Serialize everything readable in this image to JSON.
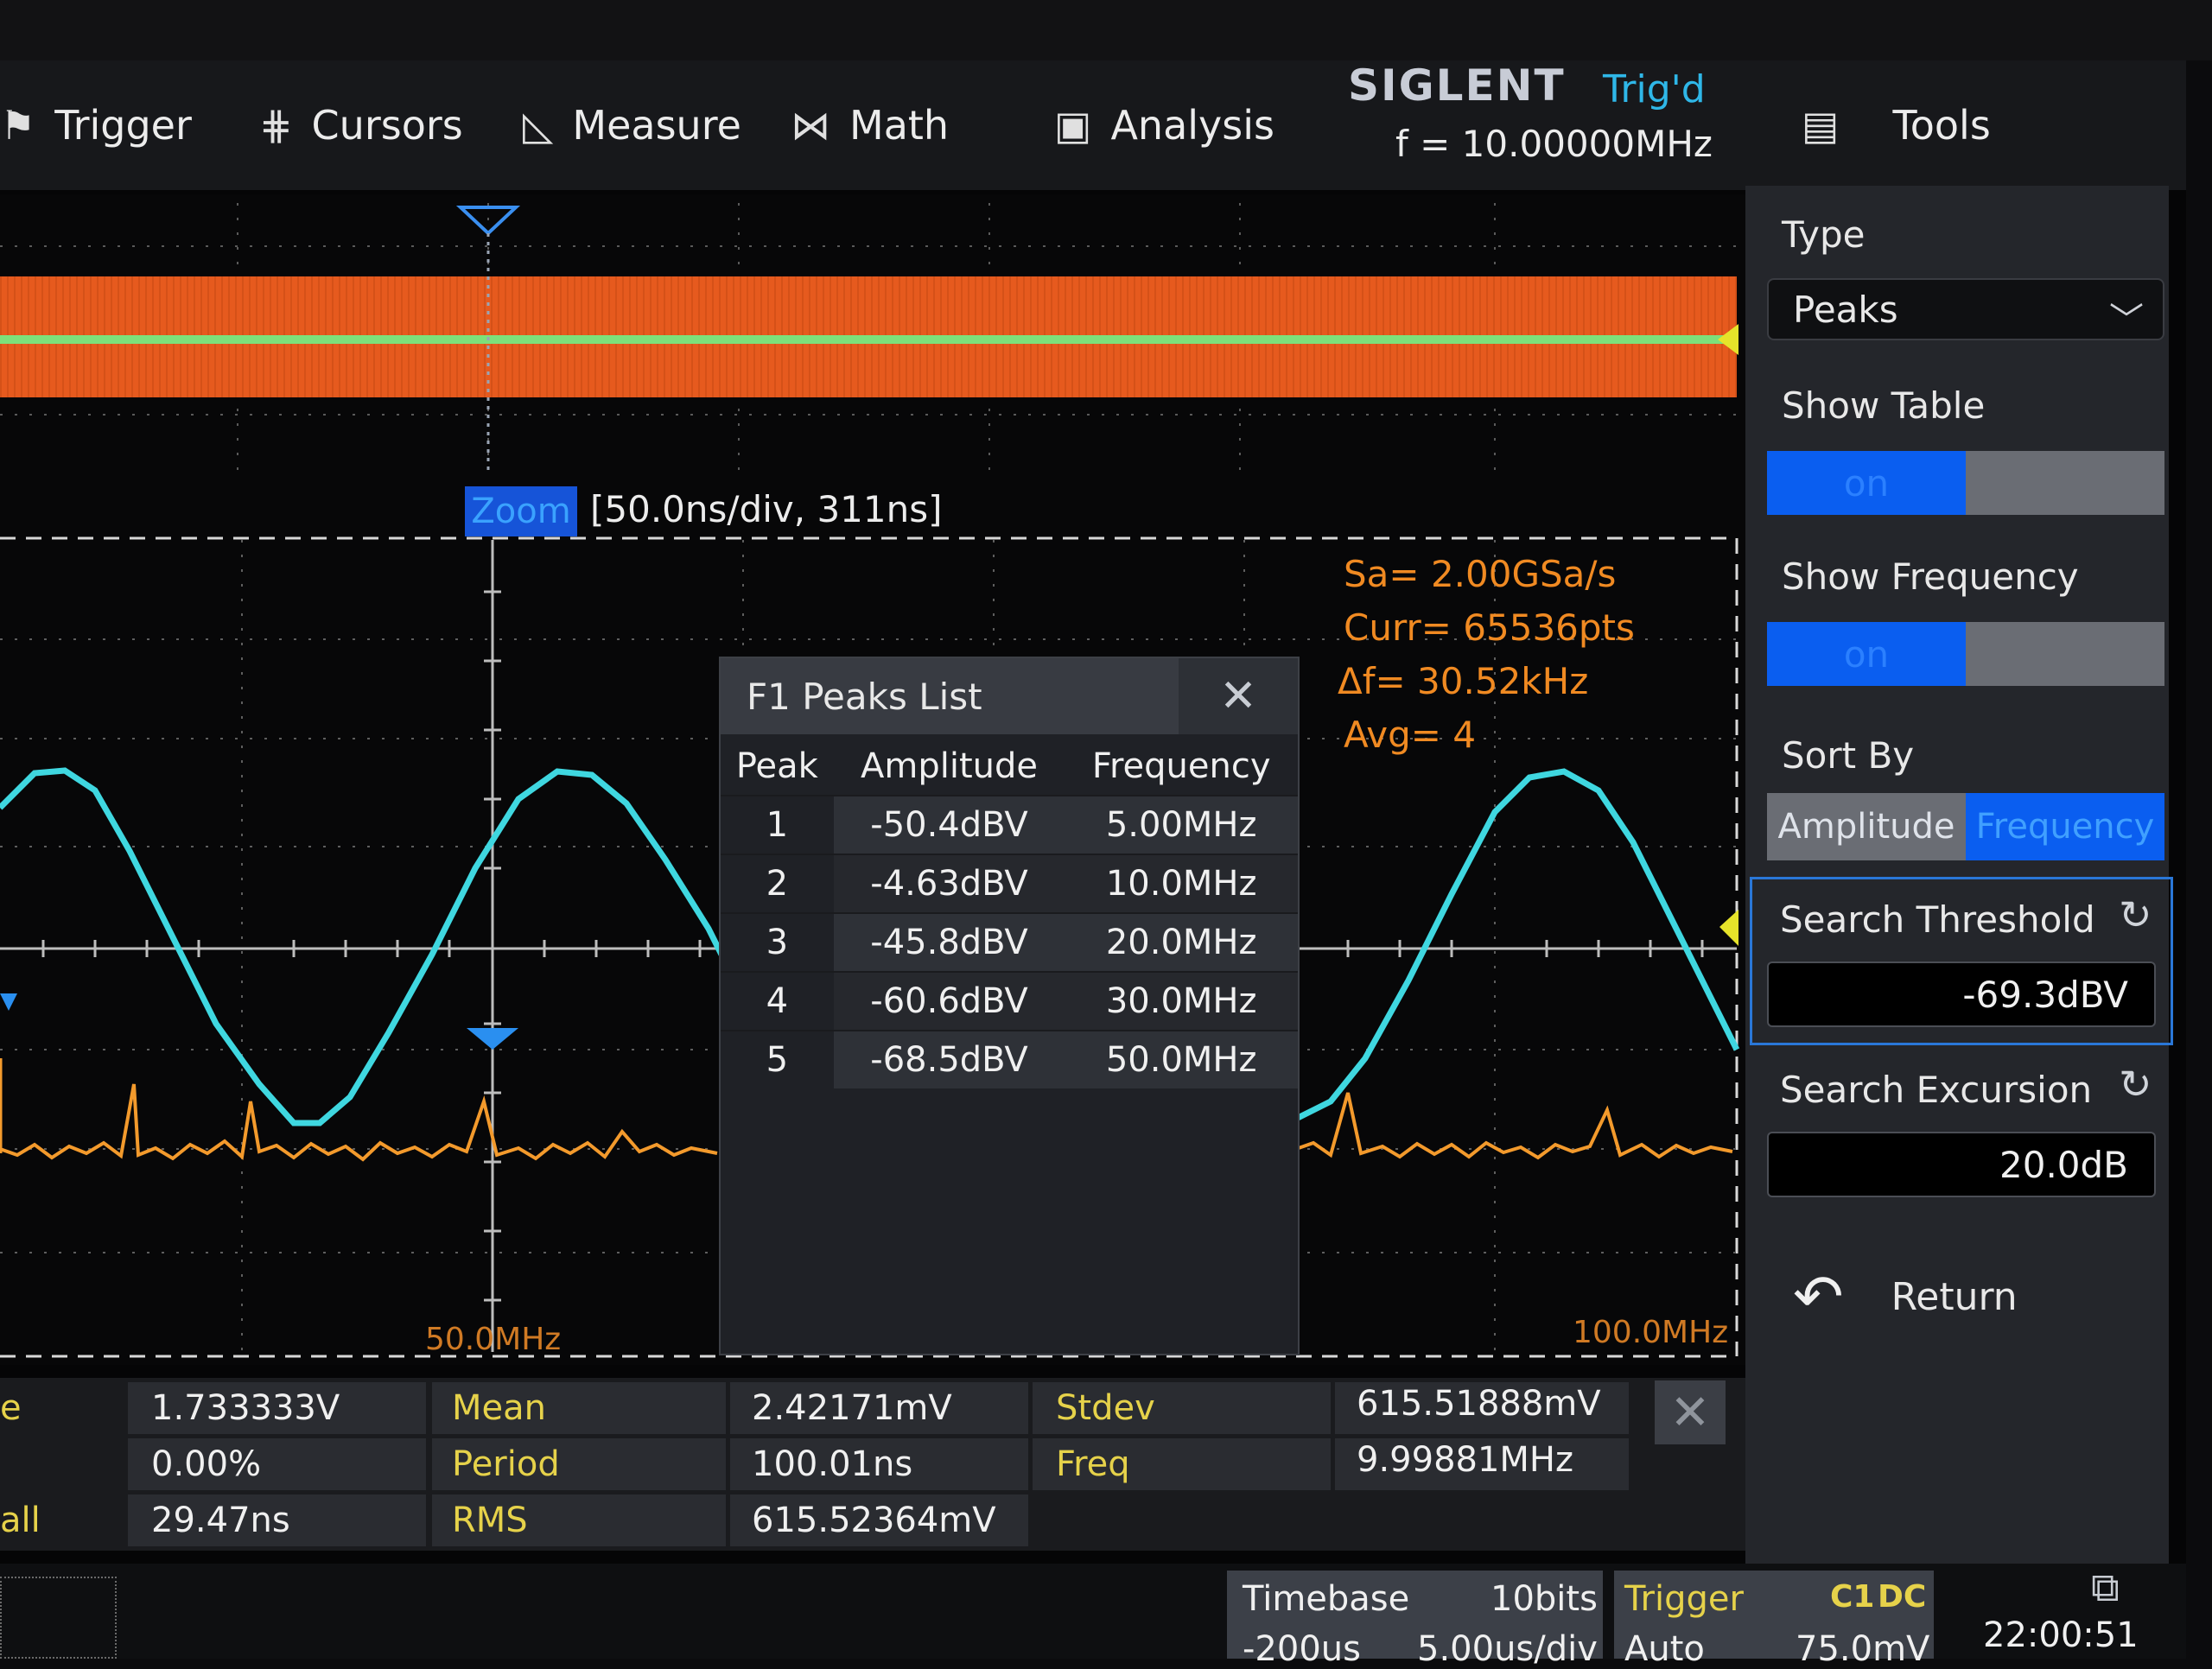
{
  "menu": {
    "trigger": "Trigger",
    "cursors": "Cursors",
    "measure": "Measure",
    "math": "Math",
    "analysis": "Analysis",
    "tools": "Tools"
  },
  "header": {
    "brand": "SIGLENT",
    "trig_status": "Trig'd",
    "frequency": "f = 10.00000MHz"
  },
  "zoom": {
    "badge": "Zoom",
    "info": "[50.0ns/div, 311ns]"
  },
  "fft_info": {
    "sample_rate": "Sa= 2.00GSa/s",
    "curr": "Curr= 65536pts",
    "delta_f": "Δf= 30.52kHz",
    "avg": "Avg= 4"
  },
  "freq_axis": {
    "mid": "50.0MHz",
    "end": "100.0MHz"
  },
  "peaks_list": {
    "title": "F1 Peaks List",
    "columns": [
      "Peak",
      "Amplitude",
      "Frequency"
    ],
    "rows": [
      {
        "peak": "1",
        "amplitude": "-50.4dBV",
        "frequency": "5.00MHz"
      },
      {
        "peak": "2",
        "amplitude": "-4.63dBV",
        "frequency": "10.0MHz"
      },
      {
        "peak": "3",
        "amplitude": "-45.8dBV",
        "frequency": "20.0MHz"
      },
      {
        "peak": "4",
        "amplitude": "-60.6dBV",
        "frequency": "30.0MHz"
      },
      {
        "peak": "5",
        "amplitude": "-68.5dBV",
        "frequency": "50.0MHz"
      }
    ]
  },
  "right_panel": {
    "type_label": "Type",
    "type_value": "Peaks",
    "show_table_label": "Show Table",
    "show_table_value": "on",
    "show_frequency_label": "Show Frequency",
    "show_frequency_value": "on",
    "sort_by_label": "Sort By",
    "sort_amplitude": "Amplitude",
    "sort_frequency": "Frequency",
    "search_threshold_label": "Search Threshold",
    "search_threshold_value": "-69.3dBV",
    "search_excursion_label": "Search Excursion",
    "search_excursion_value": "20.0dB",
    "return_label": "Return"
  },
  "measurements": {
    "row1": {
      "v1": "1.733333V",
      "label2": "Mean",
      "v2": "2.42171mV",
      "label3": "Stdev",
      "v3": "615.51888mV",
      "label0": "e"
    },
    "row2": {
      "v1": "0.00%",
      "label2": "Period",
      "v2": "100.01ns",
      "label3": "Freq",
      "v3": "9.99881MHz"
    },
    "row3": {
      "v1": "29.47ns",
      "label2": "RMS",
      "v2": "615.52364mV",
      "label0": "all"
    }
  },
  "bottom": {
    "timebase_label": "Timebase",
    "bits": "10bits",
    "tb_offset": "-200us",
    "tb_scale": "5.00us/div",
    "trigger_label": "Trigger",
    "trigger_ch": "C1",
    "trigger_coupling": "DC",
    "trigger_mode": "Auto",
    "trigger_level": "75.0mV",
    "time": "22:00:51"
  },
  "colors": {
    "ch1_trace": "#3fd7e0",
    "fft_trace": "#f39a2c",
    "accent_blue": "#0a5ef0",
    "measure_label": "#e6d24a"
  }
}
